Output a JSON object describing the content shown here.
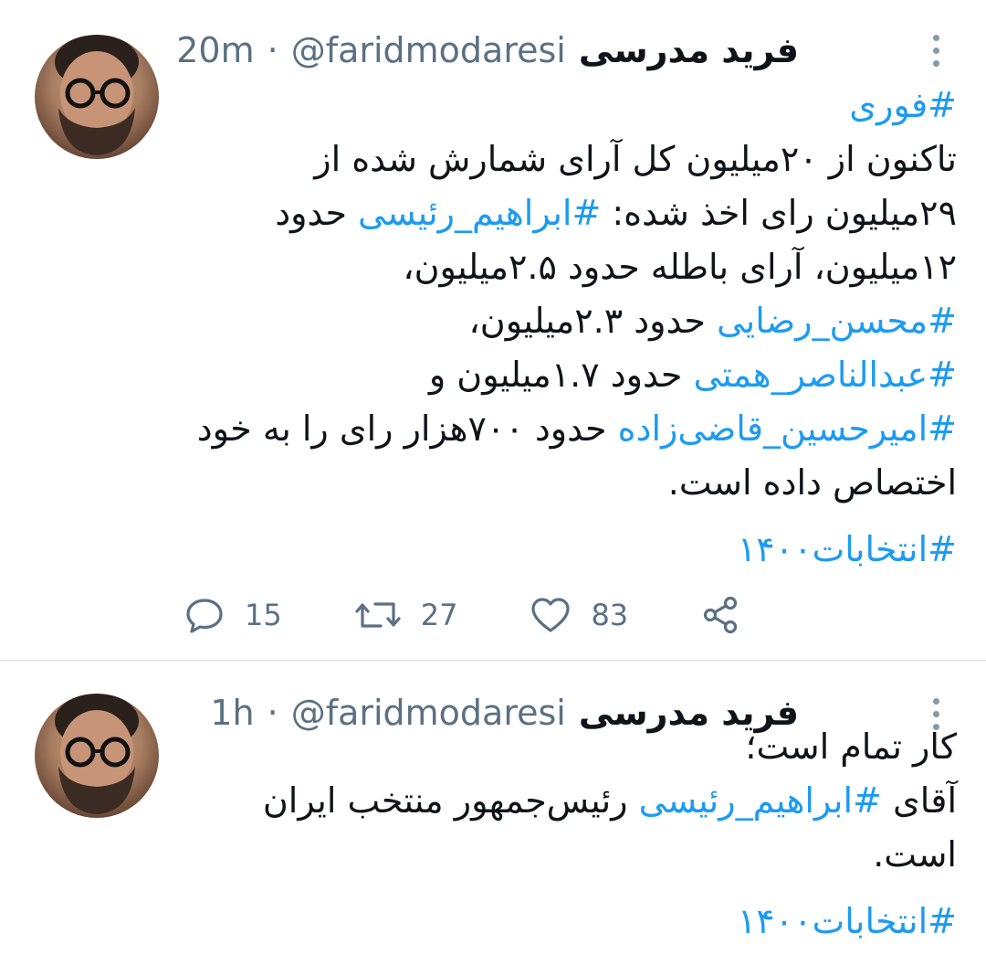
{
  "tweets": [
    {
      "author_name": "فرید مدرسی",
      "handle": "@faridmodaresi",
      "separator": "·",
      "time": "20m",
      "lines": [
        [
          {
            "t": "#فوری",
            "tag": true
          }
        ],
        [
          {
            "t": "تاکنون از ۲۰میلیون کل آرای شمارش شده از",
            "tag": false
          }
        ],
        [
          {
            "t": "۲۹میلیون رای اخذ شده: ",
            "tag": false
          },
          {
            "t": "#ابراهیم_رئیسی",
            "tag": true
          },
          {
            "t": " حدود",
            "tag": false
          }
        ],
        [
          {
            "t": "۱۲میلیون، آرای باطله حدود ۲.۵میلیون،",
            "tag": false
          }
        ],
        [
          {
            "t": "#محسن_رضایی",
            "tag": true
          },
          {
            "t": " حدود ۲.۳میلیون،",
            "tag": false
          }
        ],
        [
          {
            "t": "#عبدالناصر_همتی",
            "tag": true
          },
          {
            "t": " حدود ۱.۷میلیون و",
            "tag": false
          }
        ],
        [
          {
            "t": "#امیرحسین_قاضی‌زاده",
            "tag": true
          },
          {
            "t": " حدود ۷۰۰هزار رای را به خود",
            "tag": false
          }
        ],
        [
          {
            "t": "اختصاص داده است.",
            "tag": false
          }
        ],
        "gap",
        [
          {
            "t": "#انتخابات۱۴۰۰",
            "tag": true
          }
        ]
      ],
      "actions": {
        "replies": "15",
        "retweets": "27",
        "likes": "83"
      }
    },
    {
      "author_name": "فرید مدرسی",
      "handle": "@faridmodaresi",
      "separator": "·",
      "time": "1h",
      "lines": [
        [
          {
            "t": "کار تمام است؛",
            "tag": false
          }
        ],
        [
          {
            "t": "آقای ",
            "tag": false
          },
          {
            "t": "#ابراهیم_رئیسی",
            "tag": true
          },
          {
            "t": " رئیس‌جمهور منتخب ایران",
            "tag": false
          }
        ],
        [
          {
            "t": "است.",
            "tag": false
          }
        ],
        "gap",
        [
          {
            "t": "#انتخابات۱۴۰۰",
            "tag": true
          }
        ]
      ]
    }
  ],
  "icons": {
    "reply": "reply-bubble-icon",
    "retweet": "retweet-arrows-icon",
    "like": "heart-icon",
    "share": "share-nodes-icon",
    "more": "vertical-dots-icon"
  },
  "colors": {
    "hashtag": "#1d9bf0",
    "meta": "#5b7083",
    "icon": "#5b7083",
    "divider": "#e6ecf0"
  }
}
